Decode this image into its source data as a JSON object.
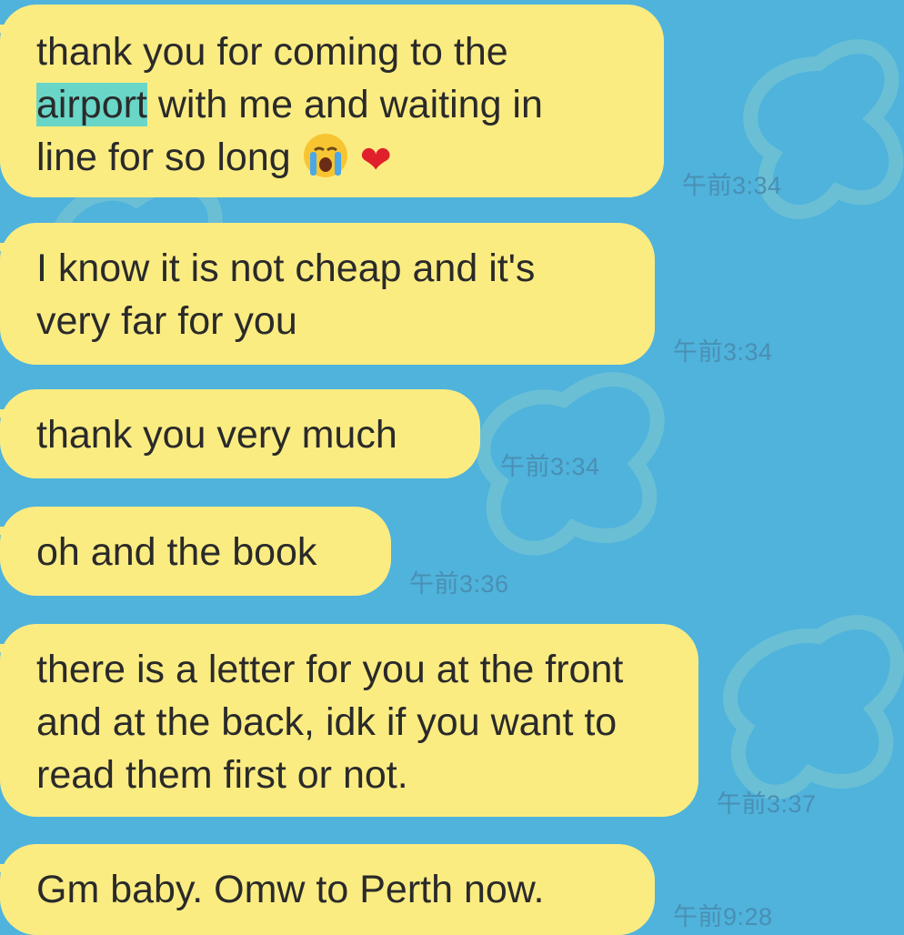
{
  "messages": [
    {
      "text_before": "thank you for coming to the",
      "highlight": "airport",
      "text_after": "with me and waiting in",
      "line3": "line for so long",
      "emoji_1": "crying-face",
      "emoji_2": "red-heart",
      "time": "午前3:34"
    },
    {
      "text": "I know it is not cheap and it's very far for you",
      "time": "午前3:34"
    },
    {
      "text": "thank you very much",
      "time": "午前3:34"
    },
    {
      "text": "oh and the book",
      "time": "午前3:36"
    },
    {
      "text": "there is a letter for you at the front and at the back, idk if you want to read them first or not.",
      "time": "午前3:37"
    },
    {
      "text": "Gm baby. Omw to Perth now.",
      "time": "午前9:28"
    }
  ],
  "colors": {
    "background": "#4fb3dc",
    "bubble": "#fbec82",
    "highlight": "#69d6c7",
    "timestamp": "#4a8fb3",
    "text": "#2a2a2a"
  }
}
